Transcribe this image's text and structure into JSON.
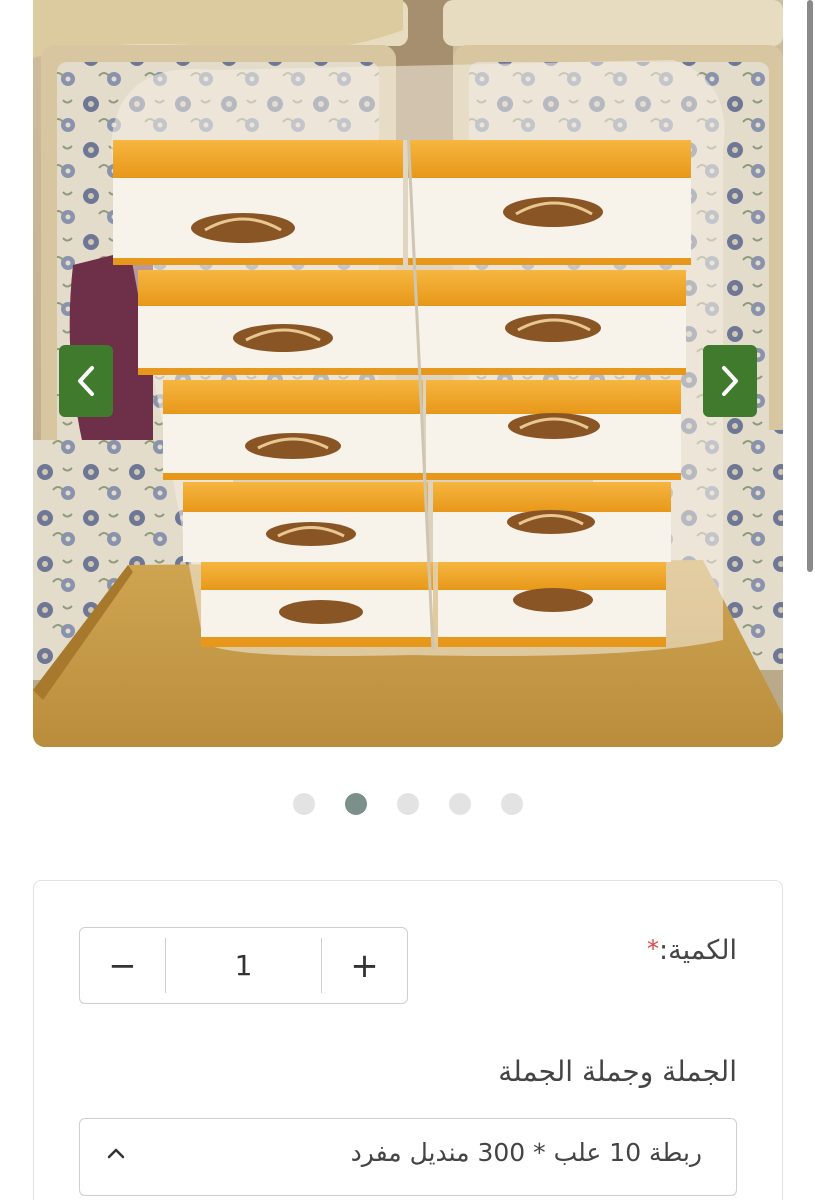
{
  "carousel": {
    "prev_icon": "chevron-left-icon",
    "next_icon": "chevron-right-icon",
    "dots_total": 5,
    "active_dot": 2,
    "nav_color": "#3f7a2d"
  },
  "options": {
    "quantity_label": "الكمية:",
    "quantity_required_mark": "*",
    "quantity_value": "1",
    "decrement_symbol": "−",
    "increment_symbol": "+",
    "variant_label": "الجملة وجملة الجملة",
    "variant_selected": "ربطة 10 علب * 300 منديل مفرد",
    "variant_chevron_icon": "chevron-up-icon"
  }
}
